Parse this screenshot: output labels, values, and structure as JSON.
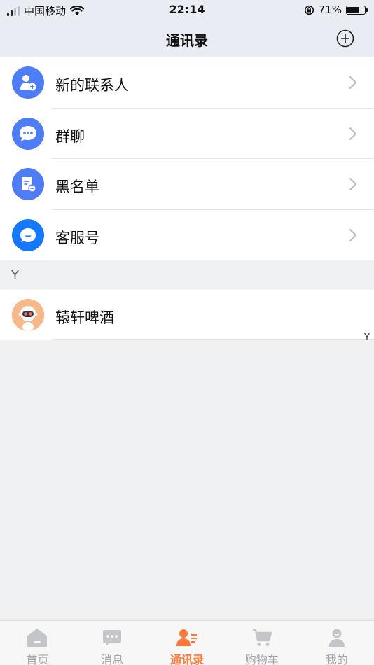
{
  "status_bar": {
    "carrier": "中国移动",
    "time": "22:14",
    "battery_percent": "71%",
    "battery_level": 0.71
  },
  "header": {
    "title": "通讯录",
    "add_icon": "plus-circle-icon"
  },
  "menu_items": [
    {
      "label": "新的联系人",
      "icon": "new-contact-icon",
      "color": "#4f7cf7"
    },
    {
      "label": "群聊",
      "icon": "group-chat-icon",
      "color": "#4f7cf7"
    },
    {
      "label": "黑名单",
      "icon": "blacklist-icon",
      "color": "#4f7cf7"
    },
    {
      "label": "客服号",
      "icon": "customer-service-icon",
      "color": "#1677ff"
    }
  ],
  "section": {
    "letter": "Y",
    "contacts": [
      {
        "name": "辕轩啤酒",
        "avatar_color": "#f7b98a"
      }
    ]
  },
  "index_bar": [
    "Y"
  ],
  "tabs": [
    {
      "label": "首页",
      "icon": "home-icon",
      "active": false
    },
    {
      "label": "消息",
      "icon": "message-icon",
      "active": false
    },
    {
      "label": "通讯录",
      "icon": "contacts-icon",
      "active": true
    },
    {
      "label": "购物车",
      "icon": "cart-icon",
      "active": false
    },
    {
      "label": "我的",
      "icon": "profile-icon",
      "active": false
    }
  ],
  "colors": {
    "accent": "#ff7a3a",
    "inactive_tab": "#a4a6ab",
    "header_bg": "#e9edf3"
  }
}
